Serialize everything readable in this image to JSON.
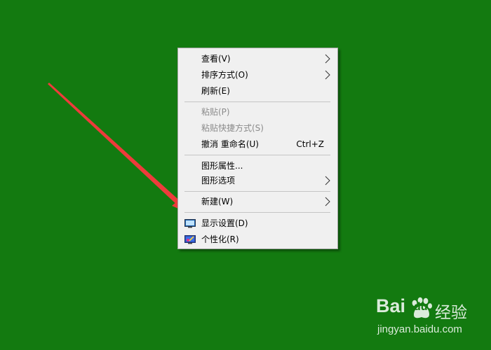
{
  "desktop": {
    "background_color": "#137a10"
  },
  "context_menu": {
    "items": [
      {
        "label": "查看(V)",
        "submenu": true,
        "enabled": true
      },
      {
        "label": "排序方式(O)",
        "submenu": true,
        "enabled": true
      },
      {
        "label": "刷新(E)",
        "enabled": true
      },
      {
        "label": "粘贴(P)",
        "enabled": false
      },
      {
        "label": "粘贴快捷方式(S)",
        "enabled": false
      },
      {
        "label": "撤消 重命名(U)",
        "shortcut": "Ctrl+Z",
        "enabled": true
      },
      {
        "label": "图形属性...",
        "enabled": true
      },
      {
        "label": "图形选项",
        "submenu": true,
        "enabled": true
      },
      {
        "label": "新建(W)",
        "submenu": true,
        "enabled": true
      },
      {
        "label": "显示设置(D)",
        "icon": "display-icon",
        "enabled": true
      },
      {
        "label": "个性化(R)",
        "icon": "personalize-icon",
        "enabled": true
      }
    ]
  },
  "annotation": {
    "arrow_color": "#ee3b3b"
  },
  "watermark": {
    "brand_left": "Bai",
    "brand_right": "du",
    "brand_suffix": "经验",
    "url": "jingyan.baidu.com"
  }
}
